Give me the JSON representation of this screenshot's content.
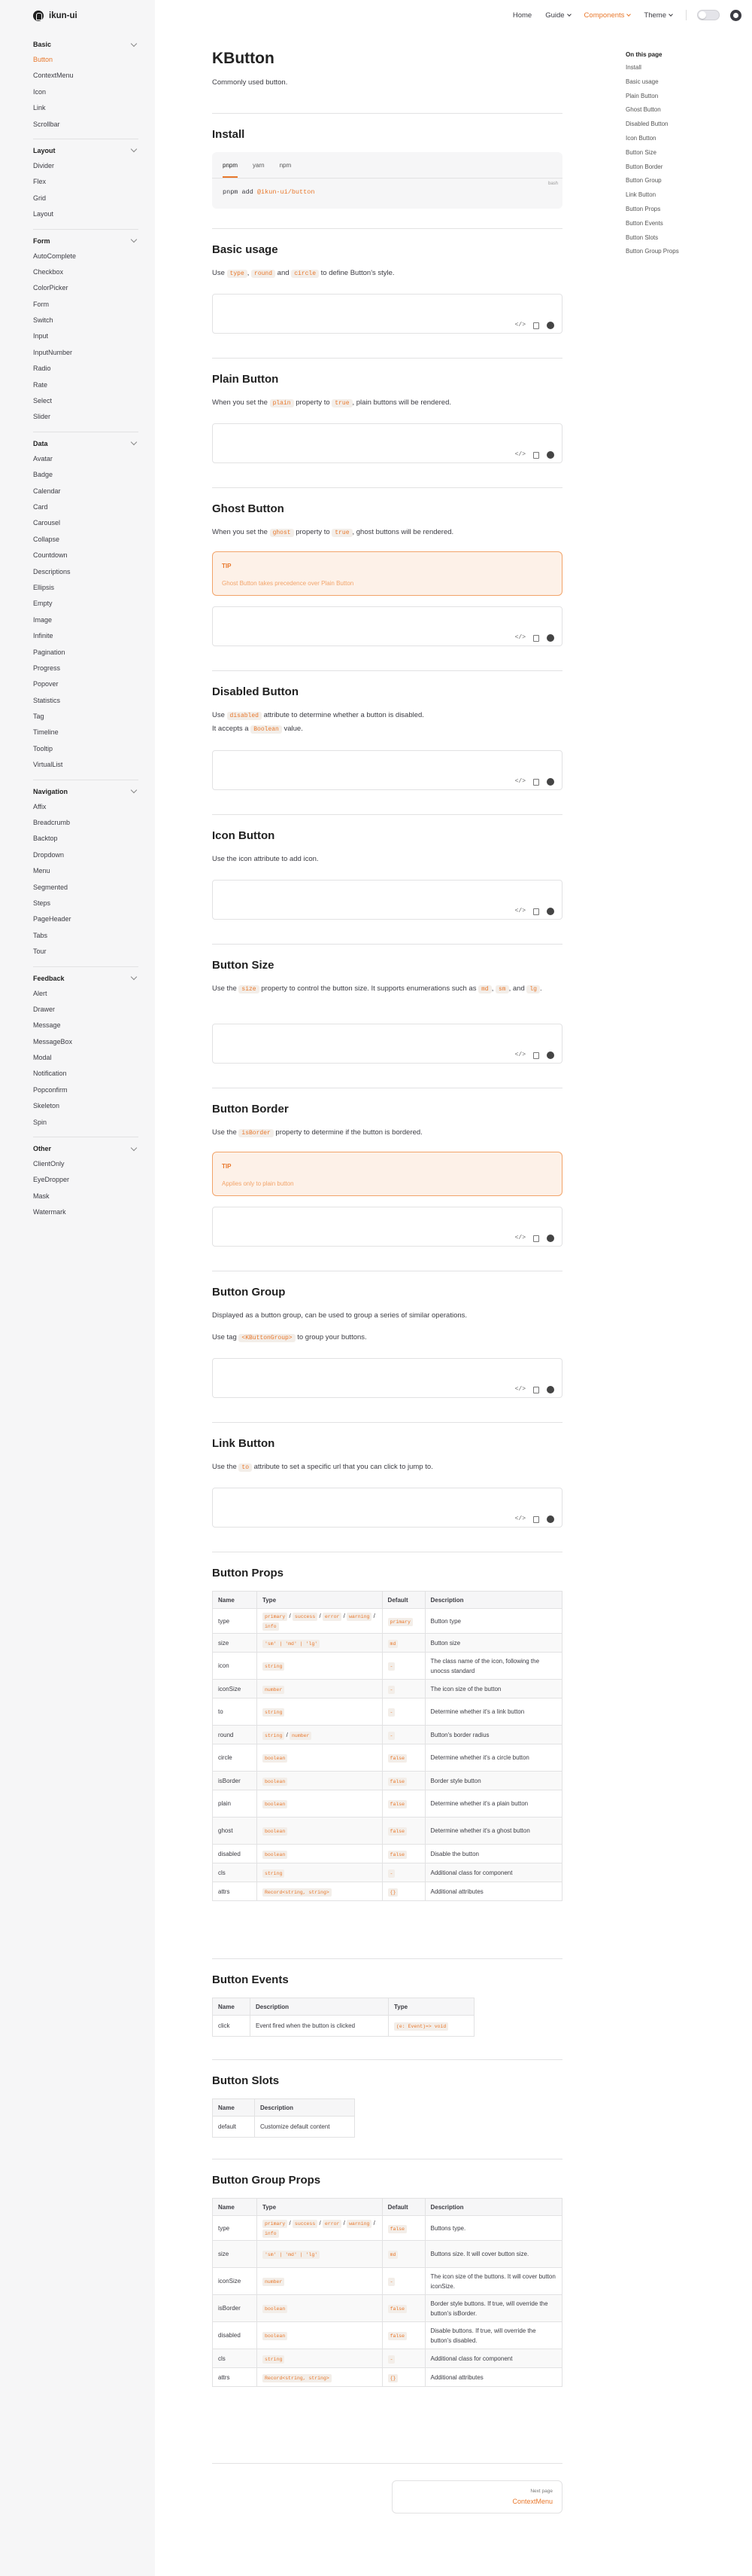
{
  "brand": {
    "name": "ikun-ui"
  },
  "topnav": {
    "links": [
      "Home",
      "Guide",
      "Components",
      "Theme"
    ]
  },
  "sidebar": {
    "groups": [
      {
        "title": "Basic",
        "items": [
          "Button",
          "ContextMenu",
          "Icon",
          "Link",
          "Scrollbar"
        ]
      },
      {
        "title": "Layout",
        "items": [
          "Divider",
          "Flex",
          "Grid",
          "Layout"
        ]
      },
      {
        "title": "Form",
        "items": [
          "AutoComplete",
          "Checkbox",
          "ColorPicker",
          "Form",
          "Switch",
          "Input",
          "InputNumber",
          "Radio",
          "Rate",
          "Select",
          "Slider"
        ]
      },
      {
        "title": "Data",
        "items": [
          "Avatar",
          "Badge",
          "Calendar",
          "Card",
          "Carousel",
          "Collapse",
          "Countdown",
          "Descriptions",
          "Ellipsis",
          "Empty",
          "Image",
          "Infinite",
          "Pagination",
          "Progress",
          "Popover",
          "Statistics",
          "Tag",
          "Timeline",
          "Tooltip",
          "VirtualList"
        ]
      },
      {
        "title": "Navigation",
        "items": [
          "Affix",
          "Breadcrumb",
          "Backtop",
          "Dropdown",
          "Menu",
          "Segmented",
          "Steps",
          "PageHeader",
          "Tabs",
          "Tour"
        ]
      },
      {
        "title": "Feedback",
        "items": [
          "Alert",
          "Drawer",
          "Message",
          "MessageBox",
          "Modal",
          "Notification",
          "Popconfirm",
          "Skeleton",
          "Spin"
        ]
      },
      {
        "title": "Other",
        "items": [
          "ClientOnly",
          "EyeDropper",
          "Mask",
          "Watermark"
        ]
      }
    ]
  },
  "page": {
    "title": "KButton",
    "lead": "Commonly used button."
  },
  "install": {
    "heading": "Install",
    "tabs": [
      "pnpm",
      "yarn",
      "npm"
    ],
    "cmd_keyword": "pnpm add ",
    "cmd_pkg": "@ikun-ui/button",
    "lang": "bash"
  },
  "sections": {
    "basic": {
      "title": "Basic usage",
      "p1": "Use ",
      "c1": "type",
      "p2": ", ",
      "c2": "round",
      "p3": " and ",
      "c3": "circle",
      "p4": " to define Button's style."
    },
    "plain": {
      "title": "Plain Button",
      "p1": "When you set the ",
      "c1": "plain",
      "p2": " property to ",
      "c2": "true",
      "p3": ", plain buttons will be rendered."
    },
    "ghost": {
      "title": "Ghost Button",
      "p1": "When you set the ",
      "c1": "ghost",
      "p2": " property to ",
      "c2": "true",
      "p3": ", ghost buttons will be rendered.",
      "tip_title": "TIP",
      "tip_body": "Ghost Button takes precedence over Plain Button"
    },
    "disabled": {
      "title": "Disabled Button",
      "p1": "Use ",
      "c1": "disabled",
      "p2": " attribute to determine whether a button is disabled.",
      "p3": "It accepts a ",
      "c2": "Boolean",
      "p4": " value."
    },
    "icon": {
      "title": "Icon Button",
      "p1": "Use the icon attribute to add icon."
    },
    "size": {
      "title": "Button Size",
      "p1": "Use the ",
      "c1": "size",
      "p2": " property to control the button size. It supports enumerations such as ",
      "c2": "md",
      "p3": ",",
      "c3": "sm",
      "p4": ", and ",
      "c4": "lg",
      "p5": "."
    },
    "border": {
      "title": "Button Border",
      "p1": "Use the ",
      "c1": "isBorder",
      "p2": " property to determine if the button is bordered.",
      "tip_title": "TIP",
      "tip_body": "Applies only to plain button"
    },
    "group": {
      "title": "Button Group",
      "p1": "Displayed as a button group, can be used to group a series of similar operations.",
      "p2": "Use tag ",
      "c1": "<KButtonGroup>",
      "p3": " to group your buttons."
    },
    "link": {
      "title": "Link Button",
      "p1": "Use the ",
      "c1": "to",
      "p2": " attribute to set a specific url that you can click to jump to."
    }
  },
  "demo_tools": {
    "code": "</>",
    "copy": "copy",
    "github": "github"
  },
  "props": {
    "title": "Button Props",
    "headers": [
      "Name",
      "Type",
      "Default",
      "Description"
    ],
    "rows": [
      {
        "name": "type",
        "type": [
          "primary",
          "success",
          "error",
          "warning",
          "info"
        ],
        "default": "primary",
        "desc": "Button type"
      },
      {
        "name": "size",
        "type": [
          "'sm' | 'md' | 'lg'"
        ],
        "default": "md",
        "desc": "Button size"
      },
      {
        "name": "icon",
        "type": [
          "string"
        ],
        "default": "-",
        "desc": "The class name of the icon, following the unocss standard"
      },
      {
        "name": "iconSize",
        "type": [
          "number"
        ],
        "default": "-",
        "desc": "The icon size of the button"
      },
      {
        "name": "to",
        "type": [
          "string"
        ],
        "default": "-",
        "desc": "Determine whether it's a link button"
      },
      {
        "name": "round",
        "type": [
          "string",
          "number"
        ],
        "default": "-",
        "desc": "Button's border radius"
      },
      {
        "name": "circle",
        "type": [
          "boolean"
        ],
        "default": "false",
        "desc": "Determine whether it's a circle button"
      },
      {
        "name": "isBorder",
        "type": [
          "boolean"
        ],
        "default": "false",
        "desc": "Border style button"
      },
      {
        "name": "plain",
        "type": [
          "boolean"
        ],
        "default": "false",
        "desc": "Determine whether it's a plain button"
      },
      {
        "name": "ghost",
        "type": [
          "boolean"
        ],
        "default": "false",
        "desc": "Determine whether it's a ghost button"
      },
      {
        "name": "disabled",
        "type": [
          "boolean"
        ],
        "default": "false",
        "desc": "Disable the button"
      },
      {
        "name": "cls",
        "type": [
          "string"
        ],
        "default": "-",
        "desc": "Additional class for component"
      },
      {
        "name": "attrs",
        "type": [
          "Record<string, string>"
        ],
        "default": "{}",
        "desc": "Additional attributes"
      }
    ]
  },
  "events": {
    "title": "Button Events",
    "headers": [
      "Name",
      "Description",
      "Type"
    ],
    "rows": [
      {
        "name": "click",
        "desc": "Event fired when the button is clicked",
        "type": "(e: Event)=> void"
      }
    ]
  },
  "slots": {
    "title": "Button Slots",
    "headers": [
      "Name",
      "Description"
    ],
    "rows": [
      {
        "name": "default",
        "desc": "Customize default content"
      }
    ]
  },
  "group_props": {
    "title": "Button Group Props",
    "headers": [
      "Name",
      "Type",
      "Default",
      "Description"
    ],
    "rows": [
      {
        "name": "type",
        "type": [
          "primary",
          "success",
          "error",
          "warning",
          "info"
        ],
        "default": "false",
        "desc": "Buttons type."
      },
      {
        "name": "size",
        "type": [
          "'sm' | 'md' | 'lg'"
        ],
        "default": "md",
        "desc": "Buttons size. It will cover button size."
      },
      {
        "name": "iconSize",
        "type": [
          "number"
        ],
        "default": "-",
        "desc": "The icon size of the buttons. It will cover button iconSize."
      },
      {
        "name": "isBorder",
        "type": [
          "boolean"
        ],
        "default": "false",
        "desc": "Border style buttons. If true, will override the button's isBorder."
      },
      {
        "name": "disabled",
        "type": [
          "boolean"
        ],
        "default": "false",
        "desc": "Disable buttons. If true, will override the button's disabled."
      },
      {
        "name": "cls",
        "type": [
          "string"
        ],
        "default": "-",
        "desc": "Additional class for component"
      },
      {
        "name": "attrs",
        "type": [
          "Record<string, string>"
        ],
        "default": "{}",
        "desc": "Additional attributes"
      }
    ]
  },
  "toc": {
    "title": "On this page",
    "items": [
      "Install",
      "Basic usage",
      "Plain Button",
      "Ghost Button",
      "Disabled Button",
      "Icon Button",
      "Button Size",
      "Button Border",
      "Button Group",
      "Link Button",
      "Button Props",
      "Button Events",
      "Button Slots",
      "Button Group Props"
    ]
  },
  "next": {
    "label": "Next page",
    "title": "ContextMenu"
  },
  "colors": {
    "accent": "#e8782c",
    "sidebar_bg": "#f6f6f7",
    "tip_border": "#f2a46a",
    "tip_bg": "#fdf1e8"
  }
}
